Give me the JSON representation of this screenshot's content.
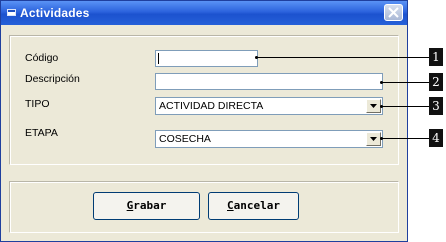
{
  "window": {
    "title": "Actividades"
  },
  "form": {
    "codigo_label": "Código",
    "codigo_value": "",
    "descripcion_label": "Descripción",
    "descripcion_value": "",
    "tipo_label": "TIPO",
    "tipo_value": "ACTIVIDAD DIRECTA",
    "etapa_label": "ETAPA",
    "etapa_value": "COSECHA"
  },
  "buttons": {
    "grabar": {
      "mnemonic": "G",
      "rest": "rabar"
    },
    "cancelar": {
      "mnemonic": "C",
      "rest": "ancelar"
    }
  },
  "callouts": [
    "1",
    "2",
    "3",
    "4"
  ],
  "icons": {
    "close": "close-icon",
    "window": "window-icon",
    "dropdown": "chevron-down-icon"
  },
  "colors": {
    "titlebar": "#2c63dd",
    "dialog_bg": "#ece9d8",
    "input_border": "#7f9db9"
  }
}
